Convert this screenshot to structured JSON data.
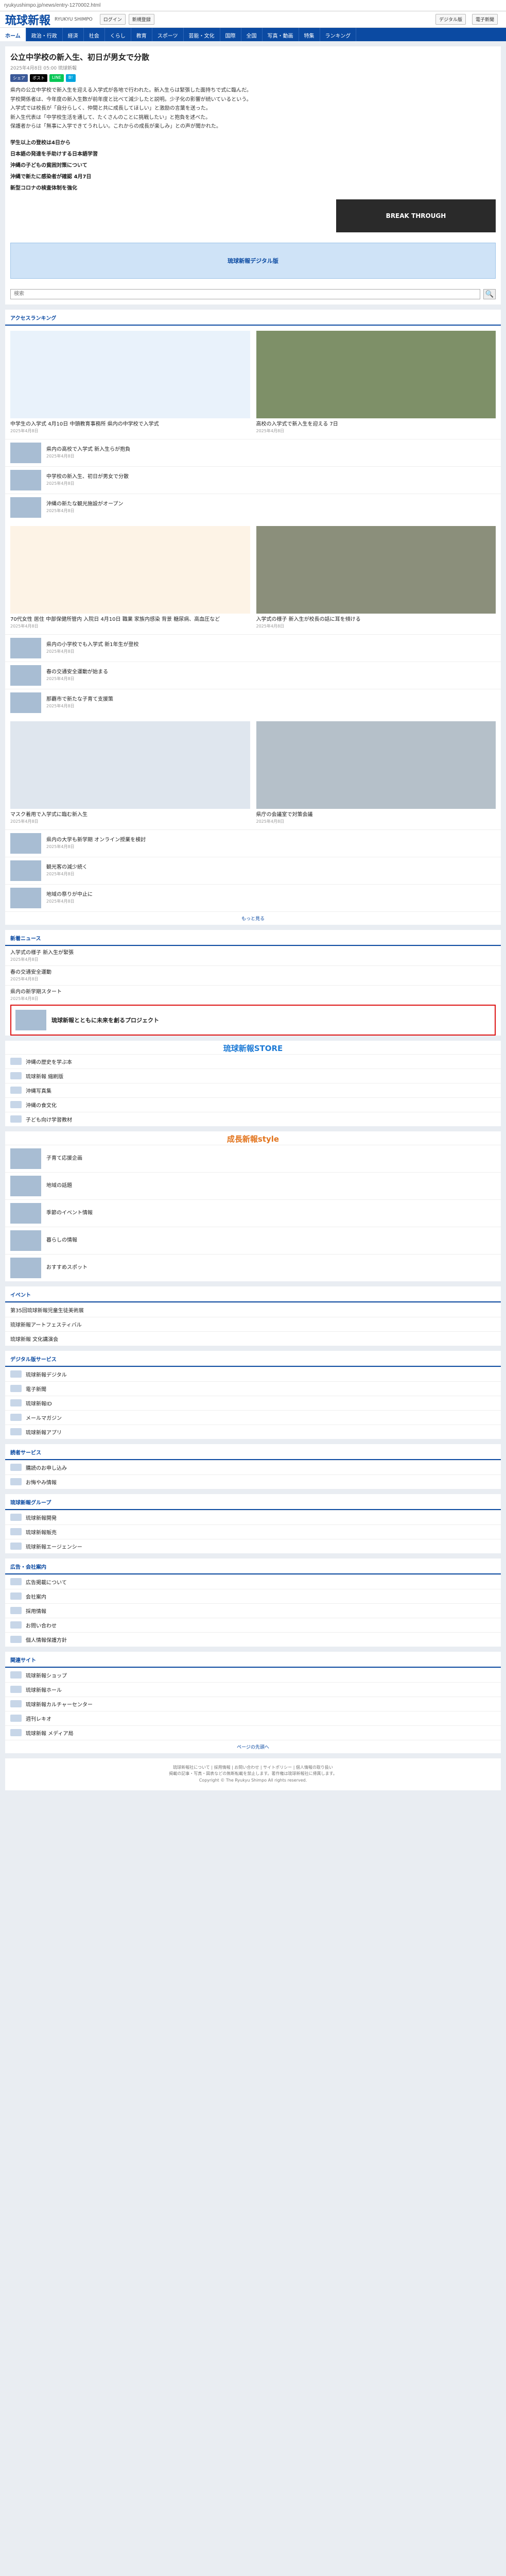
{
  "browser": {
    "url": "ryukyushimpo.jp/news/entry-1270002.html"
  },
  "header": {
    "logo": "琉球新報",
    "logo_sub": "RYUKYU SHIMPO",
    "buttons": [
      "ログイン",
      "新規登録"
    ],
    "right_links": [
      "デジタル版",
      "電子新聞"
    ]
  },
  "nav": [
    "ホーム",
    "政治・行政",
    "経済",
    "社会",
    "くらし",
    "教育",
    "スポーツ",
    "芸能・文化",
    "国際",
    "全国",
    "写真・動画",
    "特集",
    "ランキング"
  ],
  "article": {
    "title": "公立中学校の新入生、初日が男女で分散",
    "meta": "2025年4月8日 05:00 琉球新報",
    "share": [
      "シェア",
      "ポスト",
      "LINE",
      "B!"
    ],
    "body": [
      "県内の公立中学校で新入生を迎える入学式が各地で行われた。新入生らは緊張した面持ちで式に臨んだ。",
      "学校関係者は、今年度の新入生数が前年度と比べて減少したと説明。少子化の影響が続いているという。",
      "入学式では校長が「自分らしく、仲間と共に成長してほしい」と激励の言葉を送った。",
      "新入生代表は「中学校生活を通して、たくさんのことに挑戦したい」と抱負を述べた。",
      "保護者からは「無事に入学できてうれしい。これからの成長が楽しみ」との声が聞かれた。"
    ],
    "headlines": [
      "学生以上の登校は4日から",
      "日本語の発達を手助けする日本語学習",
      "沖縄の子どもの貧困対策について",
      "沖縄で新たに感染者が確認 4月7日",
      "新型コロナの検査体制を強化"
    ]
  },
  "banner": {
    "text": "BREAK THROUGH"
  },
  "sidead": {
    "text": "琉球新報デジタル版"
  },
  "search": {
    "placeholder": "検索"
  },
  "ranking": {
    "title": "アクセスランキング",
    "hero": [
      {
        "caption": "中学生の入学式 4月10日 中頭教育事務所 県内の中学校で入学式",
        "date": "2025年4月8日"
      },
      {
        "caption": "高校の入学式で新入生を迎える 7日",
        "date": "2025年4月8日"
      }
    ],
    "rows": [
      {
        "text": "県内の高校で入学式 新入生らが抱負",
        "date": "2025年4月8日"
      },
      {
        "text": "中学校の新入生、初日が男女で分散",
        "date": "2025年4月8日"
      },
      {
        "text": "沖縄の新たな観光施設がオープン",
        "date": "2025年4月8日"
      }
    ],
    "hero2": [
      {
        "caption": "70代女性 居住 中部保健所管内 入院日 4月10日 職業 家族内感染 背景 糖尿病、高血圧など",
        "date": "2025年4月8日"
      },
      {
        "caption": "入学式の様子 新入生が校長の話に耳を傾ける",
        "date": "2025年4月8日"
      }
    ],
    "rows2": [
      {
        "text": "県内の小学校でも入学式 新1年生が登校",
        "date": "2025年4月8日"
      },
      {
        "text": "春の交通安全運動が始まる",
        "date": "2025年4月8日"
      },
      {
        "text": "那覇市で新たな子育て支援策",
        "date": "2025年4月8日"
      }
    ],
    "hero3": [
      {
        "caption": "マスク着用で入学式に臨む新入生",
        "date": "2025年4月8日"
      },
      {
        "caption": "県庁の会議室で対策会議",
        "date": "2025年4月8日"
      }
    ],
    "rows3": [
      {
        "text": "県内の大学も新学期 オンライン授業を検討",
        "date": "2025年4月8日"
      },
      {
        "text": "観光客の減少続く",
        "date": "2025年4月8日"
      },
      {
        "text": "地域の祭りが中止に",
        "date": "2025年4月8日"
      }
    ],
    "more": "もっと見る"
  },
  "latest": {
    "title": "新着ニュース",
    "items": [
      {
        "text": "入学式の様子 新入生が緊張",
        "date": "2025年4月8日"
      },
      {
        "text": "春の交通安全運動",
        "date": "2025年4月8日"
      },
      {
        "text": "県内の新学期スタート",
        "date": "2025年4月8日"
      }
    ],
    "highlight": "琉球新報とともに未来を創るプロジェクト"
  },
  "store": {
    "text": "琉球新報STORE"
  },
  "store_items": [
    "沖縄の歴史を学ぶ本",
    "琉球新報 縮刷版",
    "沖縄写真集",
    "沖縄の食文化",
    "子ども向け学習教材"
  ],
  "feature": {
    "title": "成長新報style",
    "items": [
      "子育て応援企画",
      "地域の話題",
      "季節のイベント情報",
      "暮らしの情報",
      "おすすめスポット"
    ]
  },
  "events": {
    "title": "イベント",
    "items": [
      "第35回琉球新報児童生徒美術展",
      "琉球新報アートフェスティバル",
      "琉球新報 文化講演会"
    ]
  },
  "services": {
    "sections": [
      {
        "title": "デジタル版サービス",
        "items": [
          "琉球新報デジタル",
          "電子新聞",
          "琉球新報ID",
          "メールマガジン",
          "琉球新報アプリ"
        ]
      },
      {
        "title": "読者サービス",
        "items": [
          "購読のお申し込み",
          "お悔やみ情報"
        ]
      },
      {
        "title": "琉球新報グループ",
        "items": [
          "琉球新報開発",
          "琉球新報販売",
          "琉球新報エージェンシー"
        ]
      },
      {
        "title": "広告・会社案内",
        "items": [
          "広告掲載について",
          "会社案内",
          "採用情報",
          "お問い合わせ",
          "個人情報保護方針"
        ]
      },
      {
        "title": "関連サイト",
        "items": [
          "琉球新報ショップ",
          "琉球新報ホール",
          "琉球新報カルチャーセンター",
          "週刊レキオ",
          "琉球新報 メディア局"
        ]
      }
    ],
    "top_link": "ページの先頭へ"
  },
  "footer": {
    "lines": [
      "琉球新報社について | 採用情報 | お問い合わせ | サイトポリシー | 個人情報の取り扱い",
      "掲載の記事・写真・図表などの無断転載を禁止します。著作権は琉球新報社に帰属します。",
      "Copyright © The Ryukyu Shimpo All rights reserved."
    ]
  }
}
